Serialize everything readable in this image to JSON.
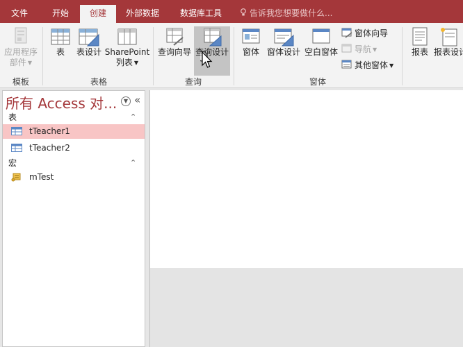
{
  "tabs": {
    "file": "文件",
    "home": "开始",
    "create": "创建",
    "external": "外部数据",
    "dbtools": "数据库工具"
  },
  "tellme": "告诉我您想要做什么...",
  "ribbon": {
    "templates": {
      "app_parts_line1": "应用程序",
      "app_parts_line2": "部件",
      "label": "模板"
    },
    "tables": {
      "table": "表",
      "table_design": "表设计",
      "sharepoint_line1": "SharePoint",
      "sharepoint_line2": "列表",
      "label": "表格"
    },
    "queries": {
      "query_wizard": "查询向导",
      "query_design": "查询设计",
      "label": "查询"
    },
    "forms": {
      "form": "窗体",
      "form_design": "窗体设计",
      "blank_form": "空白窗体",
      "form_wizard": "窗体向导",
      "navigation": "导航",
      "more_forms": "其他窗体",
      "label": "窗体"
    },
    "reports": {
      "report": "报表",
      "report_design": "报表设计"
    }
  },
  "nav": {
    "title": "所有 Access 对...",
    "groups": [
      {
        "name": "表",
        "items": [
          "tTeacher1",
          "tTeacher2"
        ]
      },
      {
        "name": "宏",
        "items": [
          "mTest"
        ]
      }
    ]
  },
  "colors": {
    "accent": "#a4373a",
    "selected_row": "#f8c5c5"
  }
}
